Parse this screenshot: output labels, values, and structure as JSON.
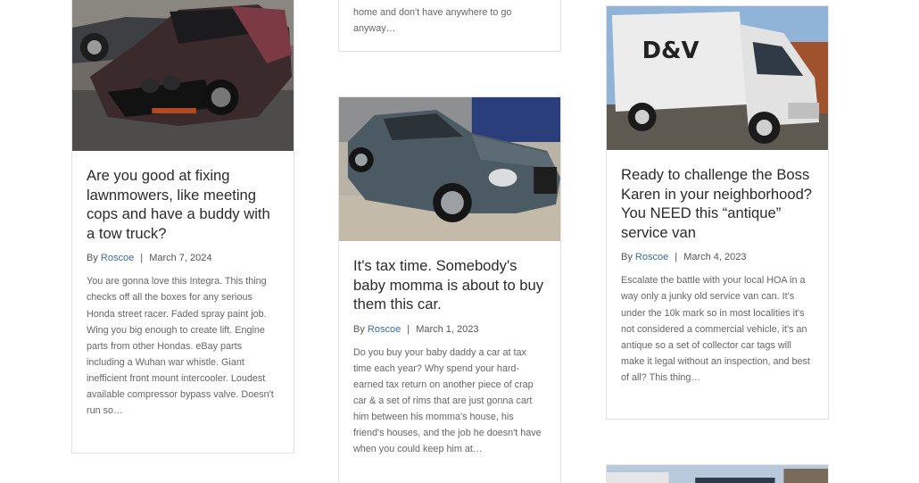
{
  "posts": [
    {
      "title": "Are you good at fixing lawnmowers, like meeting cops and have a buddy with a tow truck?",
      "by": "By",
      "author": "Roscoe",
      "date": "March 7, 2024",
      "excerpt": "You are gonna love this Integra. This thing checks off all the boxes for any serious Honda street racer. Faded spray paint job. Wing you big enough to create lift. Engine parts from other Hondas. eBay parts including a Wuhan war whistle. Giant inefficient front mount intercooler. Loudest available compressor bypass valve. Doesn't run so…"
    },
    {
      "excerpt": "home and don't have anywhere to go anyway…"
    },
    {
      "title": "It's tax time. Somebody's baby momma is about to buy them this car.",
      "by": "By",
      "author": "Roscoe",
      "date": "March 1, 2023",
      "excerpt": "Do you buy your baby daddy a car at tax time each year? Why spend your hard-earned tax return on another piece of crap car & a set of rims that are just gonna cart him between his momma's house, his friend's houses, and the job he doesn't have when you could keep him at…"
    },
    {
      "title": "Ready to challenge the Boss Karen in your neighborhood? You NEED this “antique” service van",
      "by": "By",
      "author": "Roscoe",
      "date": "March 4, 2023",
      "excerpt": "Escalate the battle with your local HOA in a way only a junky old service van can. It's under the 10k mark so in most localities it's not considered a commercial vehicle, it's an antique so a set of collector car tags will make it legal without an inspection, and best of all? This thing…",
      "van_lettering": "D&V"
    }
  ],
  "colors": {
    "link": "#3a6ea5",
    "title": "#2b2b2b",
    "text": "#666666",
    "border": "#e2e2e2"
  }
}
